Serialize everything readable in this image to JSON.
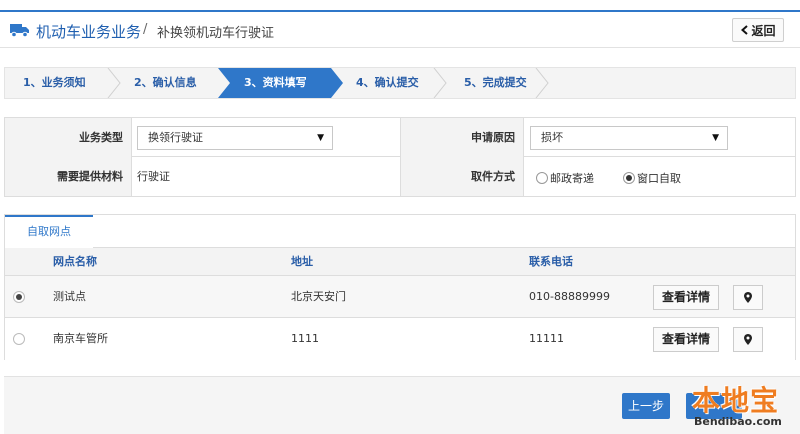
{
  "header": {
    "title": "机动车业务业务",
    "separator": "/",
    "subtitle": "补换领机动车行驶证",
    "back_label": "返回",
    "back_icon": "chevron-left-icon"
  },
  "steps": [
    {
      "label": "1、业务须知",
      "active": false
    },
    {
      "label": "2、确认信息",
      "active": false
    },
    {
      "label": "3、资料填写",
      "active": true
    },
    {
      "label": "4、确认提交",
      "active": false
    },
    {
      "label": "5、完成提交",
      "active": false
    }
  ],
  "form": {
    "business_type_label": "业务类型",
    "business_type_value": "换领行驶证",
    "reason_label": "申请原因",
    "reason_value": "损坏",
    "materials_label": "需要提供材料",
    "materials_value": "行驶证",
    "pickup_label": "取件方式",
    "pickup_options": [
      {
        "label": "邮政寄递",
        "checked": false
      },
      {
        "label": "窗口自取",
        "checked": true
      }
    ]
  },
  "pickup": {
    "tab_label": "自取网点",
    "columns": [
      "网点名称",
      "地址",
      "联系电话"
    ],
    "rows": [
      {
        "name": "测试点",
        "address": "北京天安门",
        "phone": "010-88889999",
        "detail_label": "查看详情",
        "selected": true
      },
      {
        "name": "南京车管所",
        "address": "1111",
        "phone": "11111",
        "detail_label": "查看详情",
        "selected": false
      }
    ]
  },
  "footer": {
    "prev_label": "上一步",
    "watermark_cn": "本地宝",
    "watermark_en": "Bendibao.com"
  },
  "colors": {
    "primary": "#2f77c9",
    "title": "#1f5fb0",
    "watermark": "#ef7d21"
  }
}
